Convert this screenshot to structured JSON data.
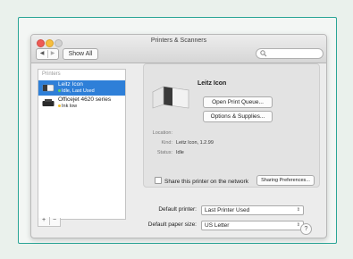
{
  "window": {
    "title": "Printers & Scanners"
  },
  "toolbar": {
    "back": "◀",
    "forward": "▶",
    "show_all_label": "Show All",
    "search_placeholder": ""
  },
  "printers": {
    "header": "Printers",
    "items": [
      {
        "name": "Leitz Icon",
        "status": "Idle, Last Used",
        "status_color": "#5ed35e",
        "selected": true
      },
      {
        "name": "Officejet 4620 series",
        "status": "Ink low",
        "status_color": "#f2c12e",
        "selected": false
      }
    ],
    "add_label": "+",
    "remove_label": "−"
  },
  "detail": {
    "printer_name": "Leitz Icon",
    "open_queue_label": "Open Print Queue...",
    "options_label": "Options & Supplies...",
    "location_label": "Location:",
    "location_value": "",
    "kind_label": "Kind:",
    "kind_value": "Leitz Icon, 1.2.99",
    "status_label": "Status:",
    "status_value": "Idle",
    "share_label": "Share this printer on the network",
    "share_checked": false,
    "sharing_prefs_label": "Sharing Preferences..."
  },
  "footer": {
    "default_printer_label": "Default printer:",
    "default_printer_value": "Last Printer Used",
    "paper_size_label": "Default paper size:",
    "paper_size_value": "US Letter",
    "help_label": "?"
  },
  "colors": {
    "accent_border": "#2aa596",
    "selection": "#2e7fd8"
  }
}
